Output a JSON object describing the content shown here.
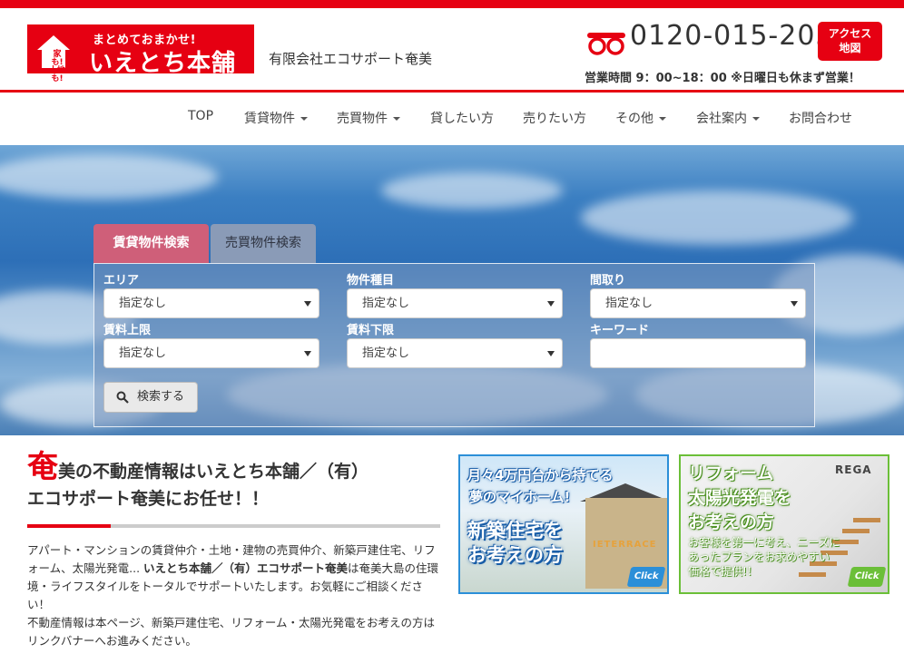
{
  "brand": {
    "accent_color": "#e60012",
    "logo_house_text": "家も!\n土地も!",
    "logo_tagline": "まとめておまかせ!",
    "logo_name": "いえとち本舗",
    "company_name": "有限会社エコサポート奄美"
  },
  "contact": {
    "phone_icon": "free-dial-icon",
    "phone_number": "0120-015-205",
    "access_line1": "アクセス",
    "access_line2": "地図",
    "hours": "営業時間 9：00~18：00 ※日曜日も休まず営業！"
  },
  "nav": {
    "items": [
      {
        "label": "TOP",
        "dropdown": false
      },
      {
        "label": "賃貸物件",
        "dropdown": true
      },
      {
        "label": "売買物件",
        "dropdown": true
      },
      {
        "label": "貸したい方",
        "dropdown": false
      },
      {
        "label": "売りたい方",
        "dropdown": false
      },
      {
        "label": "その他",
        "dropdown": true
      },
      {
        "label": "会社案内",
        "dropdown": true
      },
      {
        "label": "お問合わせ",
        "dropdown": false
      }
    ]
  },
  "search": {
    "tabs": [
      {
        "label": "賃貸物件検索",
        "active": true
      },
      {
        "label": "売買物件検索",
        "active": false
      }
    ],
    "fields": {
      "area": {
        "label": "エリア",
        "value": "指定なし"
      },
      "type": {
        "label": "物件種目",
        "value": "指定なし"
      },
      "layout": {
        "label": "間取り",
        "value": "指定なし"
      },
      "rent_max": {
        "label": "賃料上限",
        "value": "指定なし"
      },
      "rent_min": {
        "label": "賃料下限",
        "value": "指定なし"
      },
      "keyword": {
        "label": "キーワード",
        "value": ""
      }
    },
    "submit_label": "検索する"
  },
  "intro": {
    "title_first_char": "奄",
    "title_rest_line1": "美の不動産情報はいえとち本舗／（有）",
    "title_line2": "エコサポート奄美にお任せ！！",
    "text_part1": "アパート・マンションの賃貸仲介・土地・建物の売買仲介、新築戸建住宅、リフォーム、太陽光発電... ",
    "text_bold": "いえとち本舗／（有）エコサポート奄美",
    "text_part2": "は奄美大島の住環境・ライフスタイルをトータルでサポートいたします。お気軽にご相談ください！",
    "text_part3": "不動産情報は本ページ、新築戸建住宅、リフォーム・太陽光発電をお考えの方はリンクバナーへお進みください。"
  },
  "banners": {
    "new_home": {
      "line1": "月々4万円台から持てる",
      "line2": "夢のマイホーム!",
      "big1": "新築住宅を",
      "big2": "お考えの方",
      "brand": "IETERRACE",
      "click": "Click",
      "border_color": "#2b8fd8"
    },
    "reform": {
      "line1": "リフォーム",
      "line2": "太陽光発電を",
      "line3": "お考えの方",
      "desc1": "お客様を第一に考え、ニーズに",
      "desc2": "あったプランをお求めやすい",
      "desc3": "価格で提供!！",
      "brand": "REGA",
      "click": "Click",
      "border_color": "#6bbf38"
    }
  }
}
